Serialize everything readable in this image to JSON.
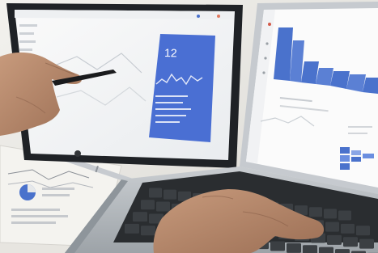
{
  "scene": {
    "type": "photograph",
    "tablet_panel": {
      "big_number": "12"
    },
    "colors": {
      "dashboard_blue": "#4a6fd3",
      "chart_blue": "#4a72cc",
      "tablet_frame": "#1f2226",
      "laptop_body": "#b9bec3",
      "desk": "#e7e5e0",
      "skin": "#b7876a",
      "pen": "#1a1b1d"
    }
  }
}
